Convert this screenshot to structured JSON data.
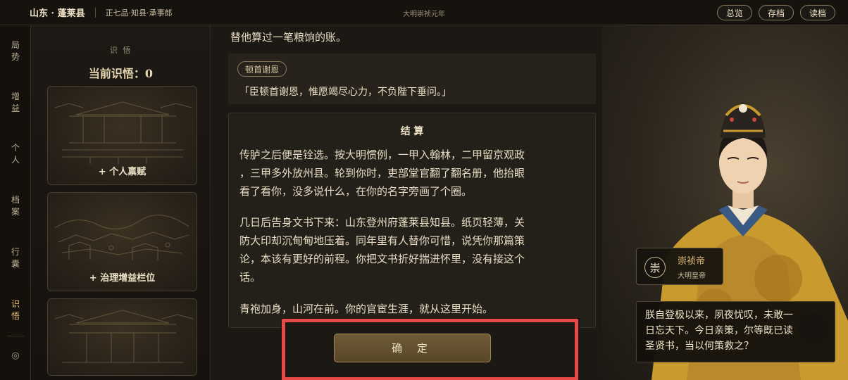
{
  "header": {
    "location": "山东 · 蓬莱县",
    "rank": "正七品·知县·承事郎",
    "era": "大明崇祯元年",
    "buttons": [
      "总览",
      "存档",
      "读档"
    ]
  },
  "nav": {
    "items": [
      {
        "label": "局势",
        "chars": [
          "局",
          "势"
        ]
      },
      {
        "label": "增益",
        "chars": [
          "增",
          "益"
        ]
      },
      {
        "label": "个人",
        "chars": [
          "个",
          "人"
        ]
      },
      {
        "label": "档案",
        "chars": [
          "档",
          "案"
        ]
      },
      {
        "label": "行囊",
        "chars": [
          "行",
          "囊"
        ]
      },
      {
        "label": "识悟",
        "chars": [
          "识",
          "悟"
        ]
      }
    ],
    "active": "识悟",
    "bottom_icon": "◎"
  },
  "panel": {
    "subtitle": "识 悟",
    "title": "当前识悟：0",
    "cards": [
      {
        "label": "+ 个人禀赋",
        "icon": "palace-hall-icon"
      },
      {
        "label": "+ 治理增益栏位",
        "icon": "city-landscape-icon"
      },
      {
        "label": "",
        "icon": "palace-gate-icon"
      }
    ]
  },
  "main": {
    "top_line": "替他算过一笔粮饷的账。",
    "quote_tag": "顿首谢恩",
    "quote_text": "「臣顿首谢恩，惟愿竭尽心力，不负陛下垂问。」",
    "result_title": "结 算",
    "paragraphs": [
      {
        "lines": [
          "传胪之后便是铨选。按大明惯例，一甲入翰林，二甲留京观政",
          "，三甲多外放州县。轮到你时，吏部堂官翻了翻名册，他抬眼",
          "看了看你，没多说什么，在你的名字旁画了个圈。"
        ]
      },
      {
        "lines": [
          "几日后告身文书下来：山东登州府蓬莱县知县。纸页轻薄，关",
          "防大印却沉甸甸地压着。同年里有人替你可惜，说凭你那篇策",
          "论，本该有更好的前程。你把文书折好揣进怀里，没有接这个",
          "话。"
        ]
      },
      {
        "lines": [
          "青袍加身，山河在前。你的官宦生涯，就从这里开始。"
        ]
      }
    ],
    "confirm_label": "确 定"
  },
  "emperor": {
    "seal_char": "崇",
    "name": "崇祯帝",
    "title": "大明皇帝",
    "speech_lines": [
      "朕自登极以来，夙夜忧叹，未敢一",
      "日忘天下。今日亲策，尔等既已读",
      "圣贤书，当以何策救之？"
    ]
  },
  "colors": {
    "accent_gold": "#d9b774",
    "highlight_red": "#e84a4a",
    "robe_yellow": "#c99a2e"
  }
}
